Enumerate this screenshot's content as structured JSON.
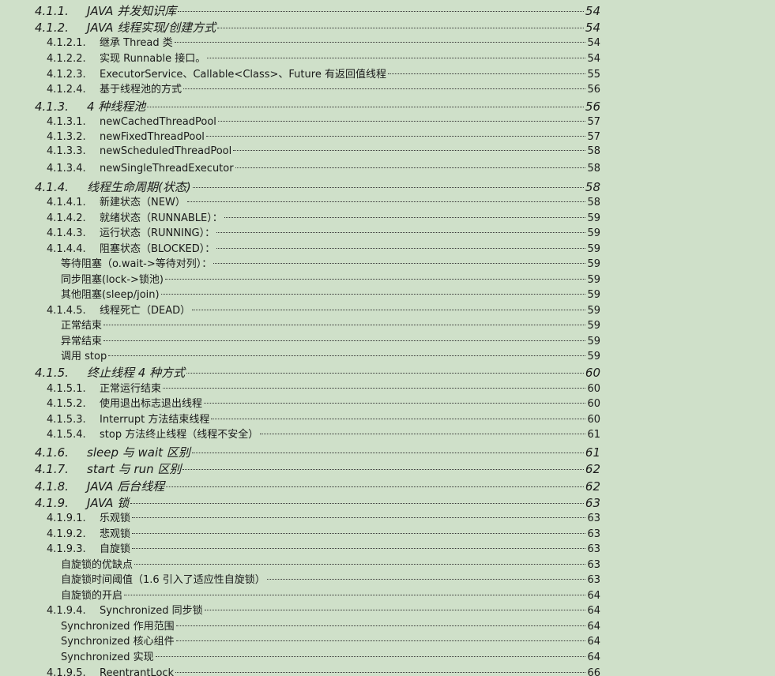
{
  "toc": [
    {
      "level": 3,
      "number": "4.1.1.",
      "title": "JAVA 并发知识库",
      "page": "54"
    },
    {
      "level": 3,
      "number": "4.1.2.",
      "title": "JAVA 线程实现/创建方式",
      "page": "54"
    },
    {
      "level": 4,
      "number": "4.1.2.1.",
      "title": "继承 Thread 类",
      "page": "54"
    },
    {
      "level": 4,
      "number": "4.1.2.2.",
      "title": "实现 Runnable 接口。",
      "page": "54"
    },
    {
      "level": 4,
      "number": "4.1.2.3.",
      "title": "ExecutorService、Callable<Class>、Future 有返回值线程",
      "page": "55"
    },
    {
      "level": 4,
      "number": "4.1.2.4.",
      "title": "基于线程池的方式",
      "page": "56"
    },
    {
      "level": 3,
      "number": "4.1.3.",
      "title": "4 种线程池",
      "page": "56"
    },
    {
      "level": 4,
      "number": "4.1.3.1.",
      "title": "newCachedThreadPool",
      "page": "57"
    },
    {
      "level": 4,
      "number": "4.1.3.2.",
      "title": "newFixedThreadPool",
      "page": "57"
    },
    {
      "level": 4,
      "number": "4.1.3.3.",
      "title": "newScheduledThreadPool",
      "page": "58"
    },
    {
      "level": 4,
      "number": "4.1.3.4.",
      "title": "newSingleThreadExecutor",
      "page": "58"
    },
    {
      "level": 3,
      "number": "4.1.4.",
      "title": "线程生命周期(状态)",
      "page": "58"
    },
    {
      "level": 4,
      "number": "4.1.4.1.",
      "title": "新建状态（NEW）",
      "page": "58"
    },
    {
      "level": 4,
      "number": "4.1.4.2.",
      "title": "就绪状态（RUNNABLE）：",
      "page": "59"
    },
    {
      "level": 4,
      "number": "4.1.4.3.",
      "title": "运行状态（RUNNING）：",
      "page": "59"
    },
    {
      "level": 4,
      "number": "4.1.4.4.",
      "title": "阻塞状态（BLOCKED）：",
      "page": "59"
    },
    {
      "level": 5,
      "number": "",
      "title": "等待阻塞（o.wait->等待对列）：",
      "page": "59"
    },
    {
      "level": 5,
      "number": "",
      "title": "同步阻塞(lock->锁池)",
      "page": "59"
    },
    {
      "level": 5,
      "number": "",
      "title": "其他阻塞(sleep/join)",
      "page": "59"
    },
    {
      "level": 4,
      "number": "4.1.4.5.",
      "title": "线程死亡（DEAD）",
      "page": "59"
    },
    {
      "level": 5,
      "number": "",
      "title": "正常结束",
      "page": "59"
    },
    {
      "level": 5,
      "number": "",
      "title": "异常结束",
      "page": "59"
    },
    {
      "level": 5,
      "number": "",
      "title": "调用 stop",
      "page": "59"
    },
    {
      "level": 3,
      "number": "4.1.5.",
      "title": "终止线程 4 种方式",
      "page": "60"
    },
    {
      "level": 4,
      "number": "4.1.5.1.",
      "title": "正常运行结束",
      "page": "60"
    },
    {
      "level": 4,
      "number": "4.1.5.2.",
      "title": "使用退出标志退出线程",
      "page": "60"
    },
    {
      "level": 4,
      "number": "4.1.5.3.",
      "title": "Interrupt 方法结束线程",
      "page": "60"
    },
    {
      "level": 4,
      "number": "4.1.5.4.",
      "title": "stop 方法终止线程（线程不安全）",
      "page": "61"
    },
    {
      "level": 3,
      "number": "4.1.6.",
      "title": "sleep 与 wait 区别",
      "page": "61"
    },
    {
      "level": 3,
      "number": "4.1.7.",
      "title": "start 与 run 区别",
      "page": "62"
    },
    {
      "level": 3,
      "number": "4.1.8.",
      "title": "JAVA 后台线程",
      "page": "62"
    },
    {
      "level": 3,
      "number": "4.1.9.",
      "title": "JAVA 锁",
      "page": "63"
    },
    {
      "level": 4,
      "number": "4.1.9.1.",
      "title": "乐观锁",
      "page": "63"
    },
    {
      "level": 4,
      "number": "4.1.9.2.",
      "title": "悲观锁",
      "page": "63"
    },
    {
      "level": 4,
      "number": "4.1.9.3.",
      "title": "自旋锁",
      "page": "63"
    },
    {
      "level": 5,
      "number": "",
      "title": "自旋锁的优缺点",
      "page": "63"
    },
    {
      "level": 5,
      "number": "",
      "title": "自旋锁时间阈值（1.6 引入了适应性自旋锁）",
      "page": "63"
    },
    {
      "level": 5,
      "number": "",
      "title": "自旋锁的开启",
      "page": "64"
    },
    {
      "level": 4,
      "number": "4.1.9.4.",
      "title": "Synchronized 同步锁",
      "page": "64"
    },
    {
      "level": 5,
      "number": "",
      "title": "Synchronized 作用范围",
      "page": "64"
    },
    {
      "level": 5,
      "number": "",
      "title": "Synchronized 核心组件",
      "page": "64"
    },
    {
      "level": 5,
      "number": "",
      "title": "Synchronized 实现",
      "page": "64"
    },
    {
      "level": 4,
      "number": "4.1.9.5.",
      "title": "ReentrantLock",
      "page": "66"
    }
  ]
}
